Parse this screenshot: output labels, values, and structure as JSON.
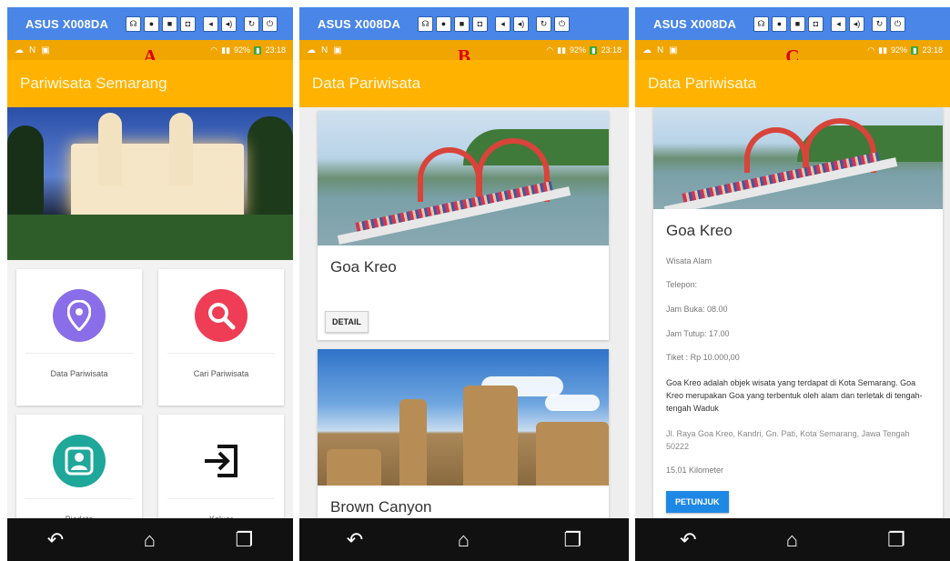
{
  "device": {
    "name": "ASUS X008DA",
    "buttons": [
      "headset-icon",
      "gear-icon",
      "video-icon",
      "camera-icon",
      "volume-down-icon",
      "volume-up-icon",
      "rotate-icon",
      "power-icon"
    ]
  },
  "status_bar": {
    "battery": "92%",
    "time": "23:18"
  },
  "colors": {
    "device_bar": "#4a86e8",
    "status_bar": "#f0a500",
    "app_bar": "#ffb300",
    "nav_bar": "#111111",
    "pin_icon_bg": "#8a6de9",
    "search_icon_bg": "#ef3d55",
    "biodata_icon_bg": "#1fa79a",
    "route_button": "#1e88e5",
    "panel_label": "#e00000"
  },
  "panels": {
    "a": {
      "label": "A",
      "app_title": "Pariwisata Semarang",
      "menu": [
        {
          "label": "Data Pariwisata",
          "icon": "map-pin-icon"
        },
        {
          "label": "Cari Pariwisata",
          "icon": "search-icon"
        },
        {
          "label": "Biodata",
          "icon": "profile-icon"
        },
        {
          "label": "Keluar",
          "icon": "logout-icon"
        }
      ]
    },
    "b": {
      "label": "B",
      "app_title": "Data Pariwisata",
      "cards": [
        {
          "title": "Goa Kreo",
          "button": "DETAIL"
        },
        {
          "title": "Brown Canyon"
        }
      ]
    },
    "c": {
      "label": "C",
      "app_title": "Data Pariwisata",
      "title": "Goa Kreo",
      "category": "Wisata Alam",
      "phone": "Telepon:",
      "open": "Jam Buka: 08.00",
      "close": "Jam Tutup: 17.00",
      "ticket": "Tiket : Rp 10.000,00",
      "description": "Goa Kreo adalah objek wisata yang terdapat di Kota Semarang. Goa Kreo merupakan Goa yang terbentuk oleh alam dan terletak di tengah-tengah Waduk",
      "address": "Jl. Raya Goa Kreo, Kandri, Gn. Pati, Kota Semarang, Jawa Tengah 50222",
      "distance": "15.01 Kilometer",
      "button": "PETUNJUK"
    }
  }
}
